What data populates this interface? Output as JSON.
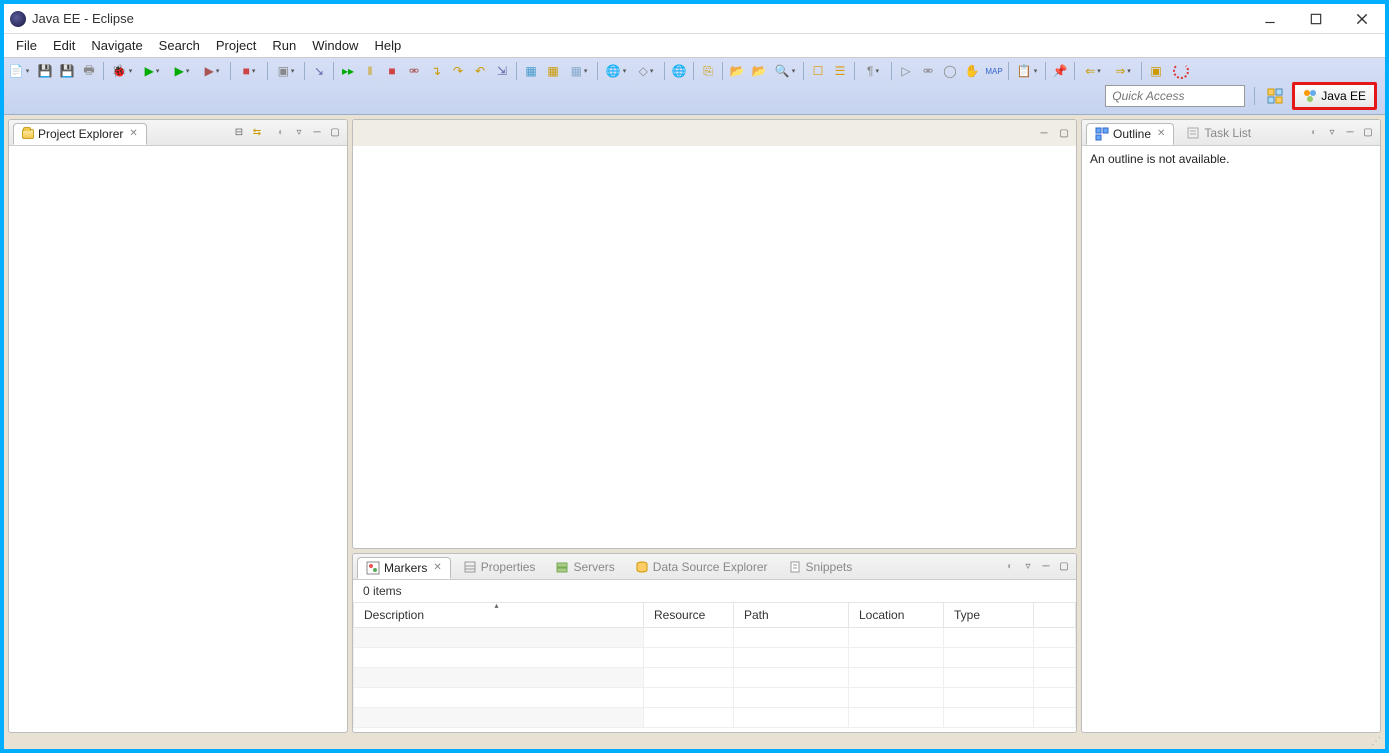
{
  "window": {
    "title": "Java EE - Eclipse"
  },
  "menu": {
    "items": [
      "File",
      "Edit",
      "Navigate",
      "Search",
      "Project",
      "Run",
      "Window",
      "Help"
    ]
  },
  "quick_access": {
    "placeholder": "Quick Access"
  },
  "perspective": {
    "current": "Java EE"
  },
  "project_explorer": {
    "title": "Project Explorer"
  },
  "outline": {
    "title": "Outline",
    "task_list_title": "Task List",
    "empty_text": "An outline is not available."
  },
  "bottom_views": {
    "tabs": [
      "Markers",
      "Properties",
      "Servers",
      "Data Source Explorer",
      "Snippets"
    ],
    "active": 0,
    "markers": {
      "summary": "0 items",
      "columns": [
        "Description",
        "Resource",
        "Path",
        "Location",
        "Type"
      ],
      "rows": []
    }
  }
}
